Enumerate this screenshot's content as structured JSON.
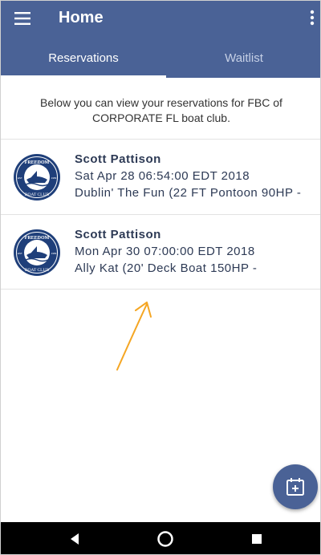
{
  "appbar": {
    "title": "Home",
    "menu_icon": "hamburger-menu-icon",
    "overflow_icon": "more-vertical-icon"
  },
  "tabs": [
    {
      "label": "Reservations",
      "active": true
    },
    {
      "label": "Waitlist",
      "active": false
    }
  ],
  "intro_text": "Below you can view your reservations for FBC of CORPORATE FL boat club.",
  "logo": {
    "top_text": "FREEDOM",
    "bottom_text": "BOAT CLUB",
    "left_year": "EST.",
    "right_year": "1989"
  },
  "reservations": [
    {
      "name": "Scott Pattison",
      "date": "Sat Apr 28 06:54:00 EDT 2018",
      "boat": "Dublin' The Fun (22 FT Pontoon 90HP -"
    },
    {
      "name": "Scott Pattison",
      "date": "Mon Apr 30 07:00:00 EDT 2018",
      "boat": "Ally Kat (20' Deck Boat 150HP -"
    }
  ],
  "fab": {
    "icon": "calendar-add-icon"
  },
  "nav": {
    "back_icon": "back-triangle-icon",
    "home_icon": "home-circle-icon",
    "recents_icon": "recents-square-icon"
  },
  "colors": {
    "primary": "#4a6296",
    "text": "#2d3a55",
    "annotation": "#f5a623"
  }
}
